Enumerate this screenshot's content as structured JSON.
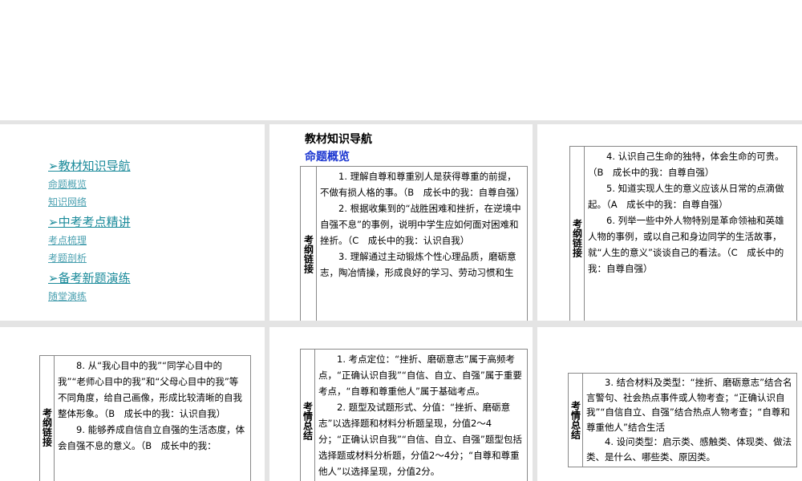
{
  "slide1": {
    "nav": [
      {
        "heading": "➢教材知识导航",
        "links": [
          "命题概览",
          "知识网络"
        ]
      },
      {
        "heading": "➢中考考点精讲",
        "links": [
          "考点梳理",
          "考题剖析"
        ]
      },
      {
        "heading": "➢备考新题演练",
        "links": [
          "随堂演练"
        ]
      }
    ]
  },
  "slide2": {
    "title": "教材知识导航",
    "subtitle": "命题概览",
    "label": "考纲链接",
    "items": [
      "1. 理解自尊和尊重别人是获得尊重的前提，不做有损人格的事。（B　成长中的我：自尊自强）",
      "2. 根据收集到的“战胜困难和挫折，在逆境中自强不息”的事例，说明中学生应如何面对困难和挫折。（C　成长中的我：认识自我）",
      "3. 理解通过主动锻炼个性心理品质，磨砺意志，陶冶情操，形成良好的学习、劳动习惯和生"
    ]
  },
  "slide3": {
    "label": "考纲链接",
    "items": [
      "4. 认识自己生命的独特，体会生命的可贵。（B　成长中的我：自尊自强）",
      "5. 知道实现人生的意义应该从日常的点滴做起。（A　成长中的我：自尊自强）",
      "6. 列举一些中外人物特别是革命领袖和英雄人物的事例，或以自己和身边同学的生活故事，就“人生的意义”谈谈自己的看法。（C　成长中的我：自尊自强）"
    ]
  },
  "slide4": {
    "label": "考纲链接",
    "items": [
      "8. 从“我心目中的我”“同学心目中的我”“老师心目中的我”和“父母心目中的我”等不同角度，给自己画像，形成比较清晰的自我整体形象。（B　成长中的我：认识自我）",
      "9. 能够养成自信自立自强的生活态度，体会自强不息的意义。（B　成长中的我："
    ]
  },
  "slide5": {
    "label": "考情总结",
    "items": [
      "1. 考点定位：“挫折、磨砺意志”属于高频考点，“正确认识自我”“自信、自立、自强”属于重要考点，“自尊和尊重他人”属于基础考点。",
      "2. 题型及试题形式、分值：“挫折、磨砺意志”以选择题和材料分析题呈现，分值2～4分；“正确认识自我”“自信、自立、自强”题型包括选择题或材料分析题，分值2～4分；“自尊和尊重他人”以选择呈现，分值2分。"
    ]
  },
  "slide6": {
    "label": "考情总结",
    "items": [
      "3. 结合材料及类型：“挫折、磨砺意志”结合名言警句、社会热点事件或人物考查；“正确认识自我”“自信自立、自强”结合热点人物考查；“自尊和尊重他人”结合生活",
      "4. 设问类型：启示类、感触类、体现类、做法类、是什么、哪些类、原因类。"
    ]
  }
}
